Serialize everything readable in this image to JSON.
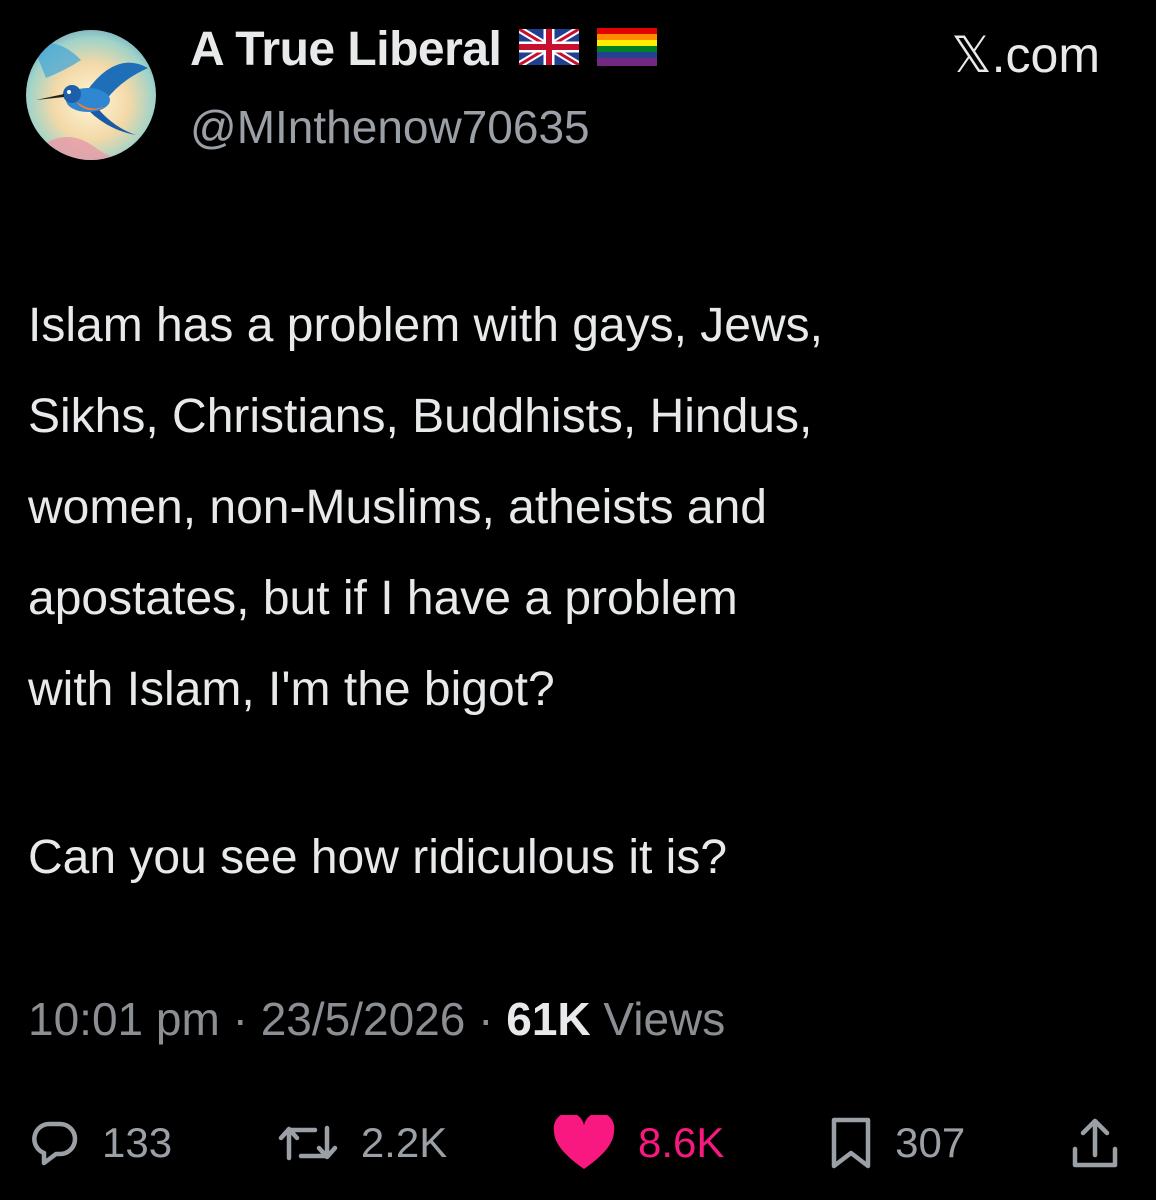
{
  "author": {
    "display_name": "A True Liberal",
    "handle": "@MInthenow70635",
    "avatar": "kingfisher-bird-icon",
    "flags": [
      "union-jack-flag-icon",
      "rainbow-flag-icon"
    ]
  },
  "brand": {
    "label": "𝕏.com"
  },
  "tweet": {
    "body": "Islam has a problem with gays, Jews,\nSikhs, Christians, Buddhists, Hindus,\nwomen, non-Muslims, atheists and\napostates, but if I have a problem\nwith Islam, I'm the bigot?",
    "question": "Can you see how ridiculous it is?"
  },
  "meta": {
    "time": "10:01 pm",
    "sep1": " · ",
    "date": "23/5/2026",
    "sep2": " · ",
    "views_count": "61K",
    "views_label": " Views"
  },
  "actions": {
    "replies": "133",
    "retweets": "2.2K",
    "likes": "8.6K",
    "bookmarks": "307"
  },
  "colors": {
    "background": "#000000",
    "text": "#e7e9ea",
    "muted": "#8b8f93",
    "like": "#f91880"
  }
}
